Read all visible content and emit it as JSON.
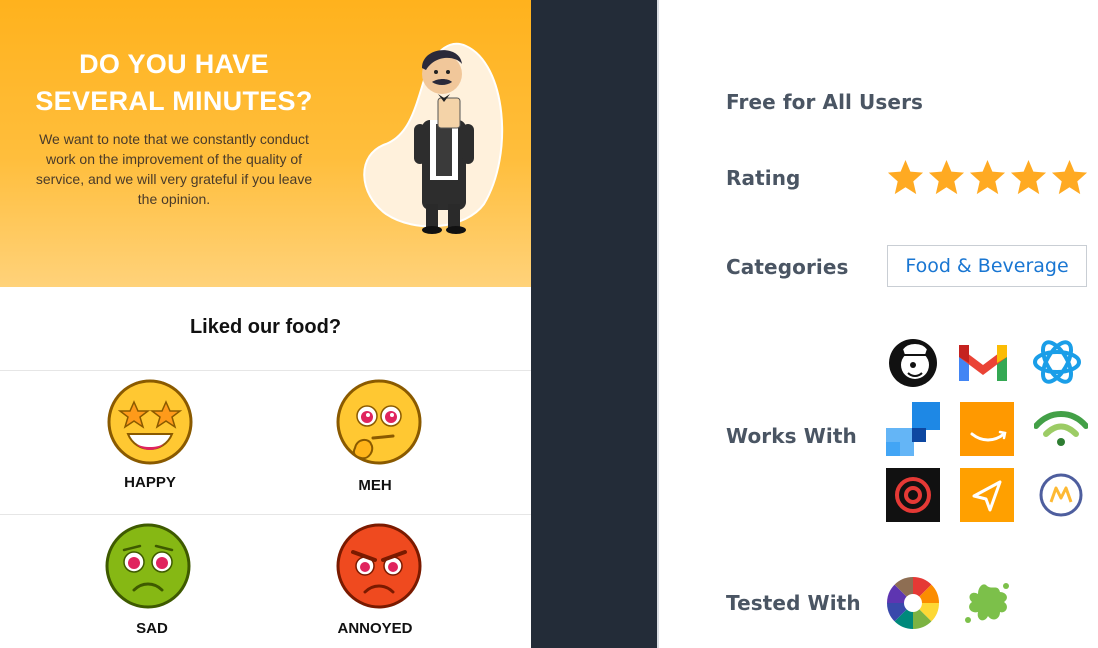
{
  "email": {
    "hero_title_line1": "DO YOU HAVE",
    "hero_title_line2": "SEVERAL MINUTES?",
    "hero_text": "We want to note that we constantly conduct work on the improvement of the quality of service, and we will very grateful if you leave the opinion.",
    "question": "Liked our food?",
    "reactions": [
      {
        "label": "HAPPY",
        "icon": "star-eyes-emoji-icon"
      },
      {
        "label": "MEH",
        "icon": "thinking-emoji-icon"
      },
      {
        "label": "SAD",
        "icon": "sick-emoji-icon"
      },
      {
        "label": "ANNOYED",
        "icon": "angry-emoji-icon"
      }
    ],
    "colors": {
      "hero": "#ffb21d",
      "gutter": "#232c38"
    }
  },
  "info": {
    "free_label": "Free for All Users",
    "rating_label": "Rating",
    "rating_stars": 5,
    "categories_label": "Categories",
    "category": "Food & Beverage",
    "works_with_label": "Works With",
    "works_with": [
      "mailchimp-icon",
      "gmail-icon",
      "sendinblue-icon",
      "stripo-blue-blocks-icon",
      "amazon-ses-icon",
      "wifi-app-icon",
      "mail-at-icon",
      "send-arrow-icon",
      "mautic-icon"
    ],
    "tested_with_label": "Tested With",
    "tested_with": [
      "color-wheel-icon",
      "splat-icon"
    ],
    "colors": {
      "label": "#4a5563",
      "accent": "#1976d2",
      "star": "#ffaa22"
    }
  }
}
